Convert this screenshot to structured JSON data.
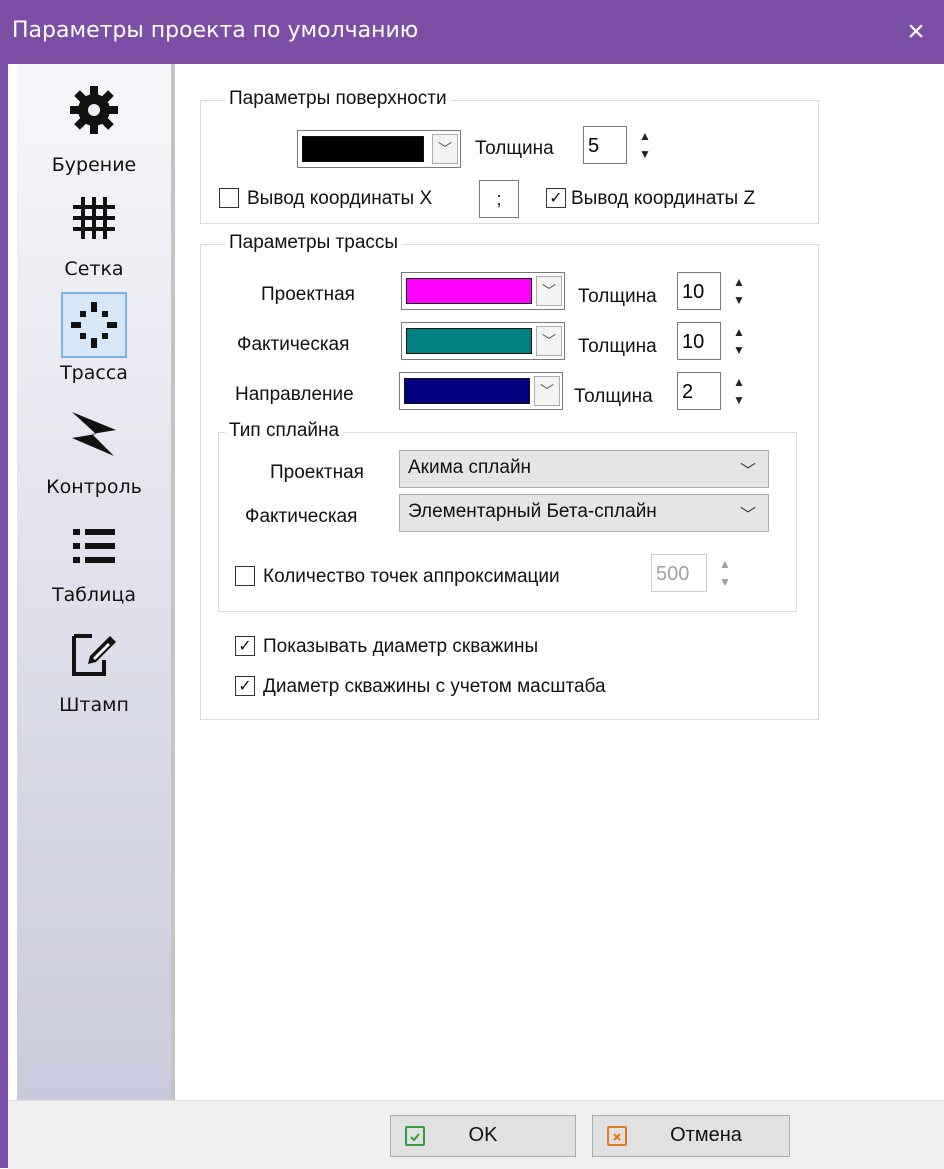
{
  "window": {
    "title": "Параметры проекта по умолчанию",
    "close_icon": "×"
  },
  "sidebar": {
    "items": [
      {
        "label": "Бурение",
        "icon": "gear-icon"
      },
      {
        "label": "Сетка",
        "icon": "grid-icon"
      },
      {
        "label": "Трасса",
        "icon": "crosshair-icon",
        "selected": true
      },
      {
        "label": "Контроль",
        "icon": "control-icon"
      },
      {
        "label": "Таблица",
        "icon": "list-icon"
      },
      {
        "label": "Штамп",
        "icon": "edit-icon"
      }
    ]
  },
  "surface": {
    "group_label": "Параметры поверхности",
    "color": "#000000",
    "thickness_label": "Толщина",
    "thickness_value": "5",
    "output_x_label": "Вывод координаты X",
    "output_x_checked": false,
    "separator_value": ";",
    "output_z_label": "Вывод координаты Z",
    "output_z_checked": true
  },
  "trace": {
    "group_label": "Параметры трассы",
    "rows": [
      {
        "label": "Проектная",
        "color": "#ff00ff",
        "thickness_label": "Толщина",
        "thickness_value": "10"
      },
      {
        "label": "Фактическая",
        "color": "#008080",
        "thickness_label": "Толщина",
        "thickness_value": "10"
      },
      {
        "label": "Направление",
        "color": "#000080",
        "thickness_label": "Толщина",
        "thickness_value": "2"
      }
    ],
    "spline": {
      "group_label": "Тип сплайна",
      "design_label": "Проектная",
      "design_value": "Акима сплайн",
      "actual_label": "Фактическая",
      "actual_value": "Элементарный Бета-сплайн",
      "points_label": "Количество точек аппроксимации",
      "points_checked": false,
      "points_value": "500"
    },
    "show_diameter_label": "Показывать диаметр скважины",
    "show_diameter_checked": true,
    "diameter_scale_label": "Диаметр скважины с учетом масштаба",
    "diameter_scale_checked": true
  },
  "footer": {
    "ok_label": "OK",
    "cancel_label": "Отмена"
  },
  "colors": {
    "titlebar": "#7b4fa6",
    "ok_icon": "#2e9e3e",
    "cancel_icon": "#e07a1f"
  }
}
